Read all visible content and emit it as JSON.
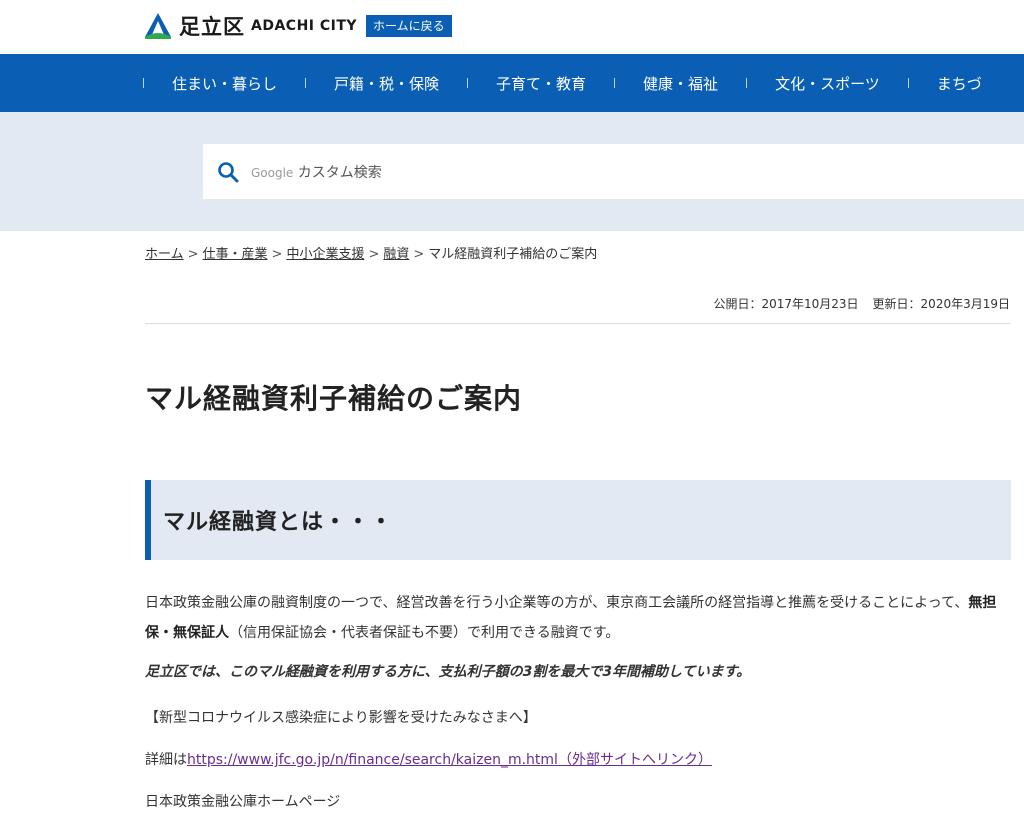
{
  "header": {
    "logo_ja": "足立区",
    "logo_en": "ADACHI CITY",
    "home_button": "ホームに戻る"
  },
  "nav": {
    "items": [
      "住まい・暮らし",
      "戸籍・税・保険",
      "子育て・教育",
      "健康・福祉",
      "文化・スポーツ",
      "まちづ"
    ]
  },
  "search": {
    "placeholder_google": "Google",
    "placeholder_text": "カスタム検索"
  },
  "breadcrumb": {
    "items": [
      "ホーム",
      "仕事・産業",
      "中小企業支援",
      "融資"
    ],
    "current": "マル経融資利子補給のご案内",
    "separator": ">"
  },
  "dates": {
    "published": "公開日：2017年10月23日",
    "updated": "更新日：2020年3月19日"
  },
  "page": {
    "title": "マル経融資利子補給のご案内",
    "section_heading": "マル経融資とは・・・",
    "intro_1": "日本政策金融公庫の融資制度の一つで、経営改善を行う小企業等の方が、東京商工会議所の経営指導と推薦を受けることによって、",
    "intro_bold": "無担保・無保証人",
    "intro_2": "（信用保証協会・代表者保証も不要）で利用できる融資です。",
    "emphasis": "足立区では、このマル経融資を利用する方に、支払利子額の3割を最大で3年間補助しています。",
    "corona": "【新型コロナウイルス感染症により影響を受けたみなさまへ】",
    "detail_prefix": "詳細は",
    "detail_link": "https://www.jfc.go.jp/n/finance/search/kaizen_m.html（外部サイトへリンク）",
    "jfc_home": "日本政策金融公庫ホームページ"
  },
  "colors": {
    "brand_blue": "#0a5fb4",
    "band_bg": "#e3e9f2",
    "link_visited": "#6a2c91"
  }
}
